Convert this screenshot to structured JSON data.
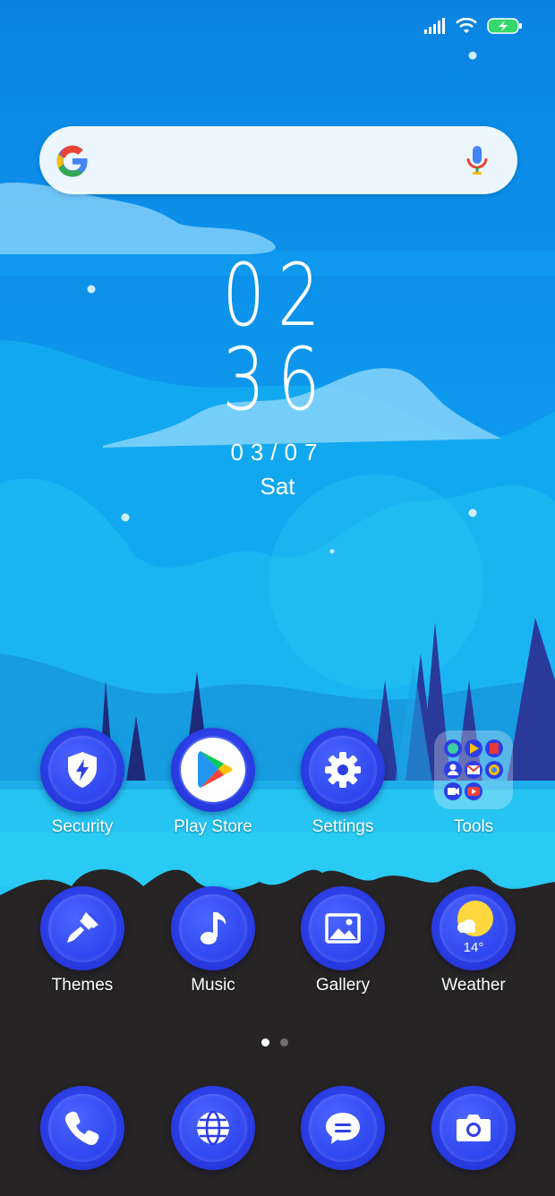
{
  "colors": {
    "sky_top": "#0b87e5",
    "sky_mid": "#14b3f4",
    "lake": "#27c8f2",
    "ground": "#262425",
    "icon_blue": "#2c3fe6",
    "white": "#ffffff"
  },
  "status_bar": {
    "icons": [
      "signal-icon",
      "wifi-icon",
      "battery-charging-icon"
    ]
  },
  "search": {
    "placeholder": "",
    "icons": [
      "google-logo-icon",
      "microphone-icon"
    ]
  },
  "clock": {
    "hours": "02",
    "minutes": "36",
    "date": "03/07",
    "day": "Sat"
  },
  "apps_row1": [
    {
      "label": "Security",
      "icon": "shield-bolt-icon"
    },
    {
      "label": "Play Store",
      "icon": "play-store-icon"
    },
    {
      "label": "Settings",
      "icon": "gear-icon"
    },
    {
      "label": "Tools",
      "icon": "folder-icon"
    }
  ],
  "apps_row2": [
    {
      "label": "Themes",
      "icon": "paintbrush-icon"
    },
    {
      "label": "Music",
      "icon": "music-note-icon"
    },
    {
      "label": "Gallery",
      "icon": "image-icon"
    },
    {
      "label": "Weather",
      "icon": "sun-cloud-icon",
      "temp": "14°"
    }
  ],
  "dock": [
    {
      "icon": "phone-icon"
    },
    {
      "icon": "browser-globe-icon"
    },
    {
      "icon": "messages-icon"
    },
    {
      "icon": "camera-icon"
    }
  ],
  "page_indicator": {
    "count": 2,
    "active": 1
  }
}
